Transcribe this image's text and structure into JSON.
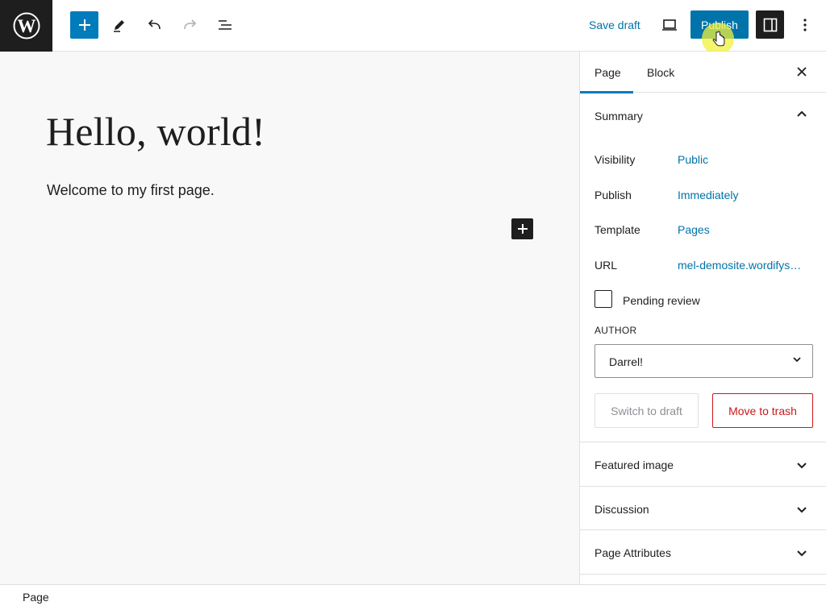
{
  "toolbar": {
    "save_draft_label": "Save draft",
    "publish_label": "Publish",
    "accent_color": "#007cba"
  },
  "editor": {
    "title": "Hello, world!",
    "paragraph": "Welcome to my first page."
  },
  "sidebar": {
    "tabs": [
      {
        "label": "Page",
        "active": true
      },
      {
        "label": "Block",
        "active": false
      }
    ],
    "summary": {
      "title": "Summary",
      "rows": [
        {
          "label": "Visibility",
          "value": "Public"
        },
        {
          "label": "Publish",
          "value": "Immediately"
        },
        {
          "label": "Template",
          "value": "Pages"
        },
        {
          "label": "URL",
          "value": "mel-demosite.wordifys…"
        }
      ],
      "pending_review_label": "Pending review",
      "pending_review_checked": false,
      "author_label": "AUTHOR",
      "author_value": "Darrel!",
      "switch_to_draft_label": "Switch to draft",
      "move_to_trash_label": "Move to trash"
    },
    "panels": [
      {
        "title": "Featured image"
      },
      {
        "title": "Discussion"
      },
      {
        "title": "Page Attributes"
      }
    ]
  },
  "statusbar": {
    "breadcrumb": "Page"
  }
}
